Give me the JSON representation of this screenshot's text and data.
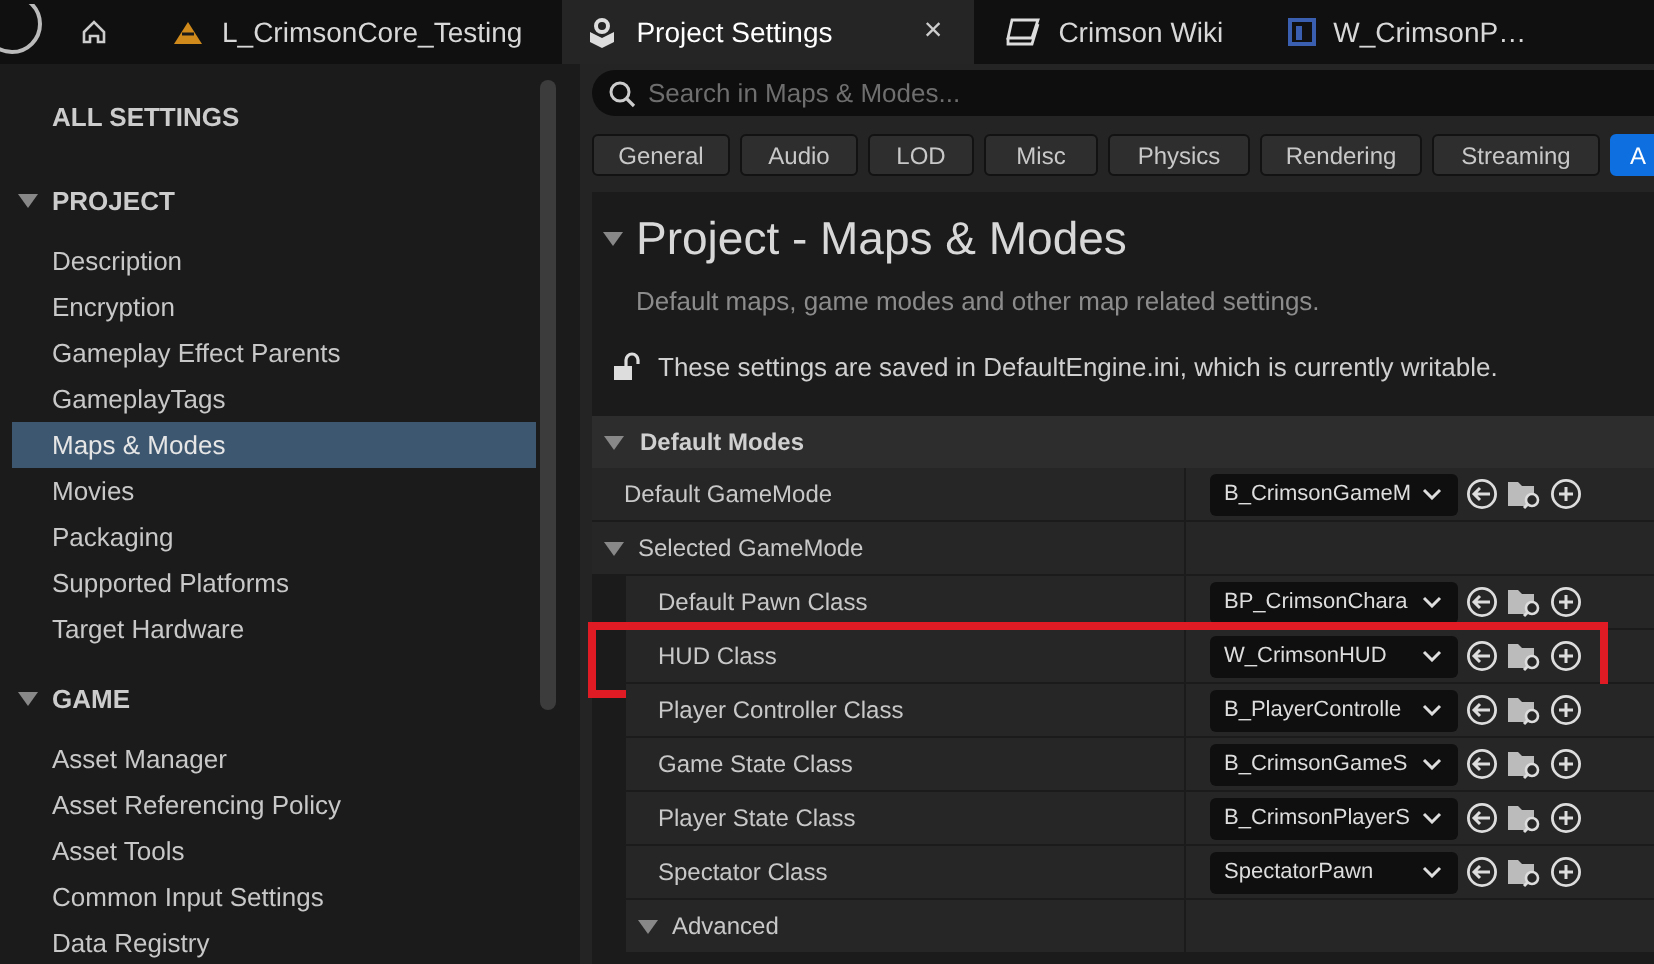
{
  "tabs": [
    {
      "kind": "home"
    },
    {
      "kind": "level",
      "label": "L_CrimsonCore_Testing",
      "selected": false
    },
    {
      "kind": "settings",
      "label": "Project Settings",
      "selected": true,
      "close": "×"
    },
    {
      "kind": "book",
      "label": "Crimson Wiki",
      "selected": false
    },
    {
      "kind": "widget",
      "label": "W_CrimsonP…",
      "selected": false
    }
  ],
  "sidebar": {
    "title": "ALL SETTINGS",
    "sections": [
      {
        "title": "PROJECT",
        "expanded": true,
        "items": [
          {
            "label": "Description",
            "selected": false
          },
          {
            "label": "Encryption",
            "selected": false
          },
          {
            "label": "Gameplay Effect Parents",
            "selected": false
          },
          {
            "label": "GameplayTags",
            "selected": false
          },
          {
            "label": "Maps & Modes",
            "selected": true
          },
          {
            "label": "Movies",
            "selected": false
          },
          {
            "label": "Packaging",
            "selected": false
          },
          {
            "label": "Supported Platforms",
            "selected": false
          },
          {
            "label": "Target Hardware",
            "selected": false
          }
        ]
      },
      {
        "title": "GAME",
        "expanded": true,
        "items": [
          {
            "label": "Asset Manager",
            "selected": false
          },
          {
            "label": "Asset Referencing Policy",
            "selected": false
          },
          {
            "label": "Asset Tools",
            "selected": false
          },
          {
            "label": "Common Input Settings",
            "selected": false
          },
          {
            "label": "Data Registry",
            "selected": false
          }
        ]
      }
    ]
  },
  "search": {
    "placeholder": "Search in Maps & Modes..."
  },
  "categories": [
    {
      "label": "General",
      "selected": false
    },
    {
      "label": "Audio",
      "selected": false
    },
    {
      "label": "LOD",
      "selected": false
    },
    {
      "label": "Misc",
      "selected": false
    },
    {
      "label": "Physics",
      "selected": false
    },
    {
      "label": "Rendering",
      "selected": false
    },
    {
      "label": "Streaming",
      "selected": false
    },
    {
      "label": "A",
      "selected": true
    }
  ],
  "page": {
    "title": "Project - Maps & Modes",
    "expanded": true,
    "description": "Default maps, game modes and other map related settings.",
    "notice": "These settings are saved in DefaultEngine.ini, which is currently writable."
  },
  "sections": [
    {
      "title": "Default Modes",
      "expanded": true,
      "rows": [
        {
          "kind": "property",
          "label": "Default GameMode",
          "value": "B_CrimsonGameM",
          "highlighted": false
        },
        {
          "kind": "group",
          "label": "Selected GameMode",
          "expanded": true,
          "children": [
            {
              "kind": "property",
              "label": "Default Pawn Class",
              "value": "BP_CrimsonChara",
              "highlighted": false
            },
            {
              "kind": "property",
              "label": "HUD Class",
              "value": "W_CrimsonHUD",
              "highlighted": true
            },
            {
              "kind": "property",
              "label": "Player Controller Class",
              "value": "B_PlayerControlle",
              "highlighted": false
            },
            {
              "kind": "property",
              "label": "Game State Class",
              "value": "B_CrimsonGameS",
              "highlighted": false
            },
            {
              "kind": "property",
              "label": "Player State Class",
              "value": "B_CrimsonPlayerS",
              "highlighted": false
            },
            {
              "kind": "property",
              "label": "Spectator Class",
              "value": "SpectatorPawn",
              "highlighted": false
            },
            {
              "kind": "group",
              "label": "Advanced",
              "expanded": true
            }
          ]
        }
      ]
    }
  ]
}
